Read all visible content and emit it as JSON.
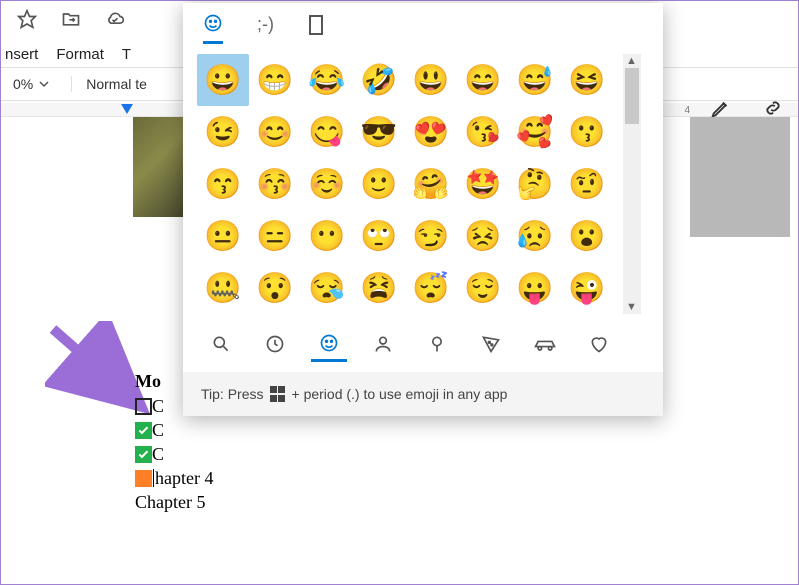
{
  "menu": {
    "insert": "nsert",
    "format": "Format",
    "tools_initial": "T"
  },
  "toolbar": {
    "zoom": "0%",
    "style": "Normal te"
  },
  "ruler": {
    "mark4": "4"
  },
  "list": {
    "title": "Mo",
    "row1_text": "C",
    "row2_text": "C",
    "row3_text": "C",
    "row4_text": "hapter 4",
    "row5_text": "Chapter 5"
  },
  "emoji_picker": {
    "tabs": {
      "emoji": "☺",
      "kaomoji": ";-)",
      "symbols": "▭"
    },
    "grid": [
      "😀",
      "😁",
      "😂",
      "🤣",
      "😃",
      "😄",
      "😅",
      "😆",
      "😉",
      "😊",
      "😋",
      "😎",
      "😍",
      "😘",
      "🥰",
      "😗",
      "😙",
      "😚",
      "☺️",
      "🙂",
      "🤗",
      "🤩",
      "🤔",
      "🤨",
      "😐",
      "😑",
      "😶",
      "🙄",
      "😏",
      "😣",
      "😥",
      "😮",
      "🤐",
      "😯",
      "😪",
      "😫",
      "😴",
      "😌",
      "😛",
      "😜"
    ],
    "categories": [
      "search",
      "recent",
      "smiley",
      "people",
      "balloon",
      "food",
      "car",
      "heart"
    ],
    "tip_prefix": "Tip: Press ",
    "tip_suffix": " + period (.) to use emoji in any app"
  }
}
